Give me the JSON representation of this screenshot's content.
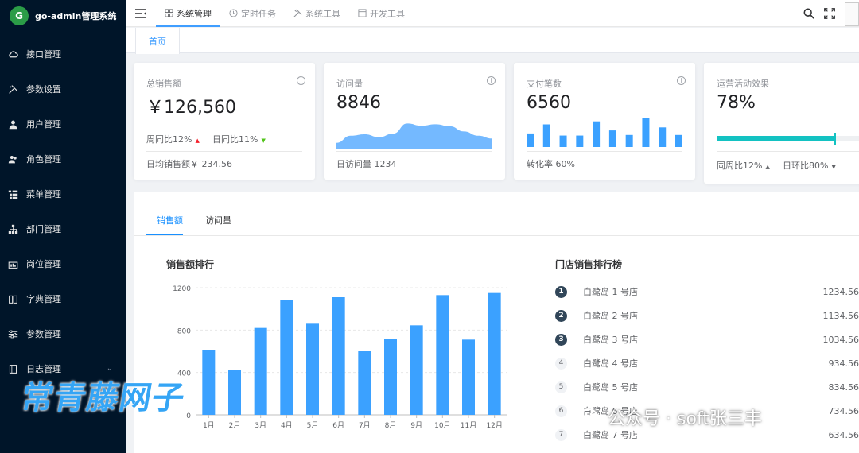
{
  "app": {
    "title": "go-admin管理系统",
    "logo_glyph": "G"
  },
  "sidebar": {
    "items": [
      {
        "label": "接口管理",
        "icon": "cloud-icon"
      },
      {
        "label": "参数设置",
        "icon": "tools-icon"
      },
      {
        "label": "用户管理",
        "icon": "user-icon"
      },
      {
        "label": "角色管理",
        "icon": "users-icon"
      },
      {
        "label": "菜单管理",
        "icon": "tree-table-icon"
      },
      {
        "label": "部门管理",
        "icon": "org-tree-icon"
      },
      {
        "label": "岗位管理",
        "icon": "post-icon"
      },
      {
        "label": "字典管理",
        "icon": "book-icon"
      },
      {
        "label": "参数管理",
        "icon": "sliders-icon"
      },
      {
        "label": "日志管理",
        "icon": "log-icon"
      }
    ]
  },
  "header": {
    "tabs": [
      {
        "label": "系统管理",
        "icon": "grid-icon",
        "active": true
      },
      {
        "label": "定时任务",
        "icon": "clock-icon",
        "active": false
      },
      {
        "label": "系统工具",
        "icon": "tools-icon",
        "active": false
      },
      {
        "label": "开发工具",
        "icon": "dev-icon",
        "active": false
      }
    ]
  },
  "tagsbar": {
    "home": "首页"
  },
  "cards": {
    "sales": {
      "title": "总销售额",
      "value": "￥126,560",
      "week": "周同比12%",
      "day": "日同比11%",
      "footer": "日均销售额￥ 234.56"
    },
    "visits": {
      "title": "访问量",
      "value": "8846",
      "footer": "日访问量 1234"
    },
    "payments": {
      "title": "支付笔数",
      "value": "6560",
      "footer": "转化率 60%"
    },
    "operations": {
      "title": "运营活动效果",
      "value": "78%",
      "progress": 0.78,
      "week": "同周比12%",
      "day": "日环比80%"
    }
  },
  "panel": {
    "tabs": [
      "销售额",
      "访问量"
    ],
    "chart_title": "销售额排行",
    "rank_title": "门店销售排行榜",
    "ranks": [
      {
        "num": "1",
        "name": "白鹭岛 1 号店",
        "value": "1234.56"
      },
      {
        "num": "2",
        "name": "白鹭岛 2 号店",
        "value": "1134.56"
      },
      {
        "num": "3",
        "name": "白鹭岛 3 号店",
        "value": "1034.56"
      },
      {
        "num": "4",
        "name": "白鹭岛 4 号店",
        "value": "934.56"
      },
      {
        "num": "5",
        "name": "白鹭岛 5 号店",
        "value": "834.56"
      },
      {
        "num": "6",
        "name": "白鹭岛 6 号店",
        "value": "734.56"
      },
      {
        "num": "7",
        "name": "白鹭岛 7 号店",
        "value": "634.56"
      }
    ]
  },
  "watermark": {
    "left": "常青藤网子",
    "right": "公众号 · soft张三丰"
  },
  "colors": {
    "sidebar_bg": "#001529",
    "accent": "#1890ff",
    "bar": "#3ba1ff",
    "area": "#74b9ff",
    "progress": "#13c2c2"
  },
  "chart_data": {
    "type": "bar",
    "categories": [
      "1月",
      "2月",
      "3月",
      "4月",
      "5月",
      "6月",
      "7月",
      "8月",
      "9月",
      "10月",
      "11月",
      "12月"
    ],
    "values": [
      610,
      420,
      820,
      1080,
      860,
      1110,
      600,
      715,
      845,
      1130,
      710,
      1150
    ],
    "yticks": [
      0,
      400,
      800,
      1200
    ],
    "ylim": [
      0,
      1200
    ],
    "xlabel": "",
    "ylabel": "",
    "grid": true
  },
  "mini_charts": {
    "payments_bars": [
      0.45,
      0.75,
      0.38,
      0.38,
      0.85,
      0.55,
      0.4,
      0.95,
      0.65,
      0.4
    ],
    "visits_area": [
      0.2,
      0.45,
      0.5,
      0.4,
      0.52,
      0.88,
      0.8,
      0.85,
      0.78,
      0.6,
      0.45,
      0.35
    ]
  }
}
